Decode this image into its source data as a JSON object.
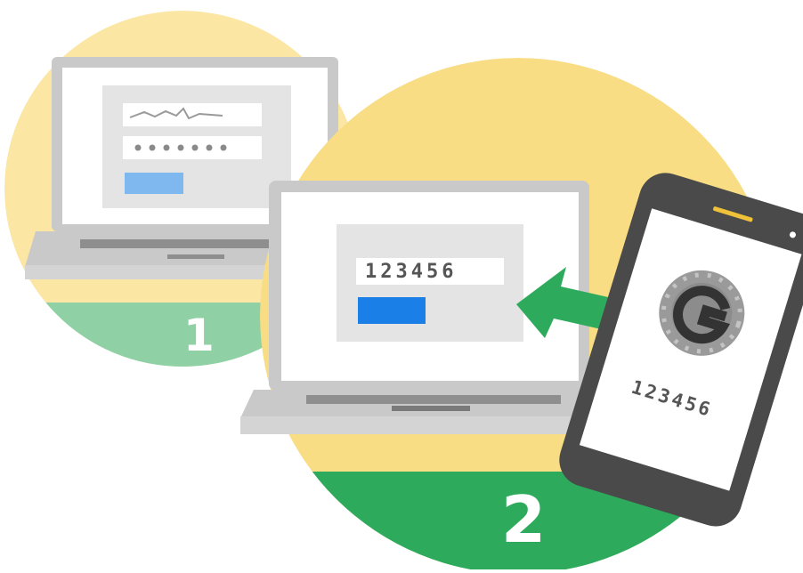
{
  "colors": {
    "circle_yellow": "#f9dd84",
    "circle_yellow_light": "#fbe6a4",
    "circle_green": "#2eaa5c",
    "circle_green_light": "#8fd1a5",
    "laptop_frame": "#c9c9c9",
    "screen_white": "#ffffff",
    "form_panel": "#e4e4e4",
    "button_light_blue": "#7fb8ee",
    "button_blue": "#1a7fe6",
    "arrow_green": "#2eaa5c",
    "phone_body": "#4a4a4a",
    "logo_gray": "#8a8a8a"
  },
  "step1": {
    "number": "1",
    "password_mask": "●●●●●●●"
  },
  "step2": {
    "number": "2",
    "code_field_value": "123456"
  },
  "phone": {
    "app_logo_letter": "G",
    "code_value": "123456"
  },
  "icons": {
    "signature": "signature-scribble",
    "arrow": "arrow-left-icon",
    "authenticator": "authenticator-g-icon"
  }
}
